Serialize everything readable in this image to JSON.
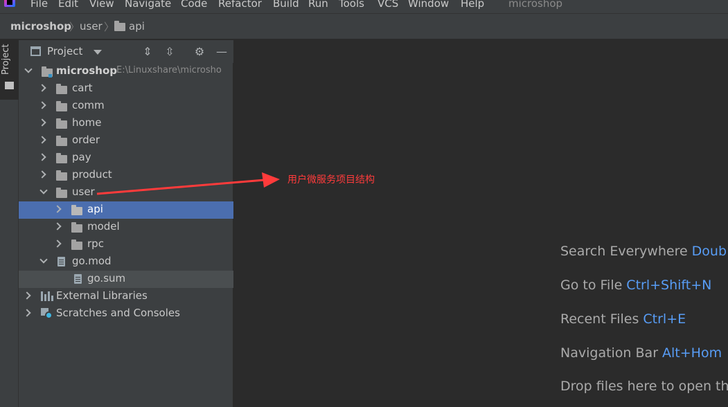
{
  "menu": {
    "items": [
      "File",
      "Edit",
      "View",
      "Navigate",
      "Code",
      "Refactor",
      "Build",
      "Run",
      "Tools",
      "VCS",
      "Window",
      "Help"
    ],
    "window_title": "microshop"
  },
  "breadcrumb": {
    "items": [
      "microshop",
      "user",
      "api"
    ]
  },
  "toolstrip": {
    "project_tab": "Project"
  },
  "panel": {
    "title": "Project"
  },
  "tree": {
    "root": {
      "label": "microshop",
      "path": "E:\\Linuxshare\\microsho"
    },
    "items": [
      "cart",
      "comm",
      "home",
      "order",
      "pay",
      "product",
      "user",
      "api",
      "model",
      "rpc",
      "go.mod",
      "go.sum",
      "External Libraries",
      "Scratches and Consoles"
    ]
  },
  "annotation": {
    "text": "用户微服务项目结构",
    "color": "#ff3b3b"
  },
  "hints": [
    {
      "label": "Search Everywhere",
      "shortcut": "Doub"
    },
    {
      "label": "Go to File",
      "shortcut": "Ctrl+Shift+N"
    },
    {
      "label": "Recent Files",
      "shortcut": "Ctrl+E"
    },
    {
      "label": "Navigation Bar",
      "shortcut": "Alt+Hom"
    },
    {
      "label": "Drop files here to open th",
      "shortcut": ""
    }
  ],
  "colors": {
    "selection": "#4b6eaf",
    "shortcut": "#589df6",
    "panel_bg": "#3c3f41",
    "editor_bg": "#2b2b2b"
  }
}
